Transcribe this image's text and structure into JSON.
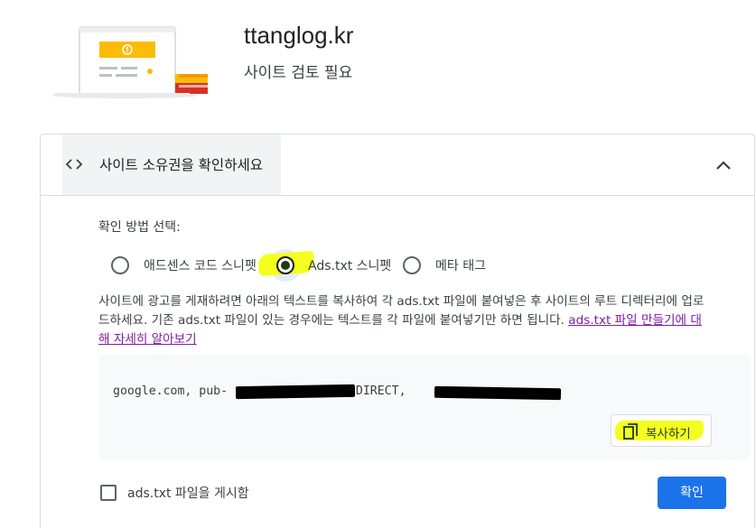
{
  "header": {
    "site": "ttanglog.kr",
    "status": "사이트 검토 필요"
  },
  "colors": {
    "accent": "#1a73e8",
    "highlight": "#f4ff1f",
    "illustration_yellow": "#fbbc04",
    "illustration_red": "#d93025"
  },
  "card": {
    "title": "사이트 소유권을 확인하세요",
    "title_icon": "code-icon",
    "collapse_icon": "chevron-up-icon",
    "method_label": "확인 방법 선택:",
    "options": [
      {
        "label": "애드센스 코드 스니펫",
        "checked": false
      },
      {
        "label": "Ads.txt 스니펫",
        "checked": true
      },
      {
        "label": "메타 태그",
        "checked": false
      }
    ],
    "description": "사이트에 광고를 게재하려면 아래의 텍스트를 복사하여 각 ads.txt 파일에 붙여넣은 후 사이트의 루트 디렉터리에 업로드하세요. 기존 ads.txt 파일이 있는 경우에는 텍스트를 각 파일에 붙여넣기만 하면 됩니다.",
    "learn_more_link": "ads.txt 파일 만들기에 대해 자세히 알아보기",
    "snippet": {
      "part1": "google.com, pub-",
      "part2": ", DIRECT, "
    },
    "copy_button": "복사하기",
    "copy_icon": "copy-icon",
    "publish_checkbox": {
      "label": "ads.txt 파일을 게시함",
      "checked": false
    },
    "confirm_button": "확인"
  }
}
